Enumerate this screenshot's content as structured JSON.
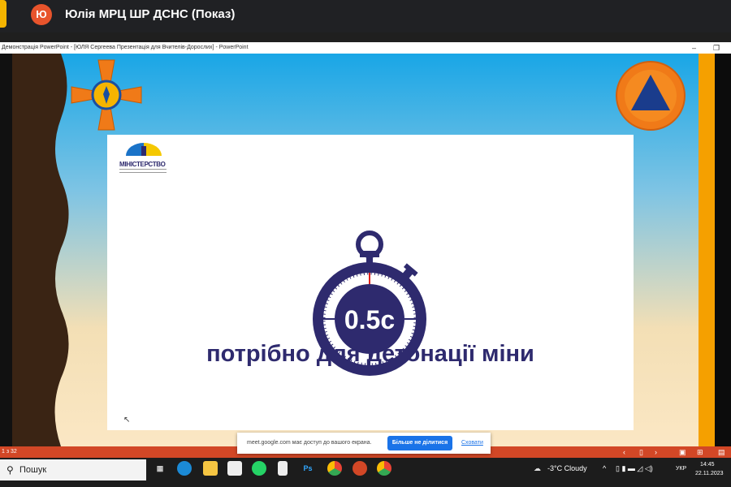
{
  "meet": {
    "avatar_letter": "Ю",
    "title": "Юлія МРЦ ШР ДСНС (Показ)"
  },
  "powerpoint": {
    "window_title": "Демонстрація PowerPoint - [ЮЛЯ Сергеева Презентація для Вчителів-Дорослих] - PowerPoint",
    "minimize": "–",
    "restore": "❐"
  },
  "slide": {
    "ministry_logo_text": "МІНІСТЕРСТВО",
    "stopwatch_value": "0.5с",
    "caption": "потрібно для детонації міни",
    "colors": {
      "navy": "#2e2a6e",
      "accent_red": "#e0201b",
      "orange": "#f5a000"
    }
  },
  "status_bar": {
    "slide_counter": "1 з 32",
    "prev": "‹",
    "next": "›",
    "icons": [
      "slide-sorter-icon",
      "normal-view-icon",
      "reading-view-icon",
      "grid-view-icon"
    ]
  },
  "share_notice": {
    "message": "meet.google.com має доступ до вашого екрана.",
    "stop_button": "Більше не ділитися",
    "hide_link": "Сховати"
  },
  "taskbar": {
    "search_placeholder": "Пошук",
    "apps": [
      "task-view",
      "edge",
      "file-explorer",
      "microsoft-store",
      "whatsapp",
      "notepad",
      "photoshop",
      "chrome",
      "powerpoint",
      "chrome"
    ],
    "ps_label": "Ps",
    "weather": "-3°C Cloudy",
    "language": "УКР",
    "time": "14:45",
    "date": "22.11.2023"
  }
}
